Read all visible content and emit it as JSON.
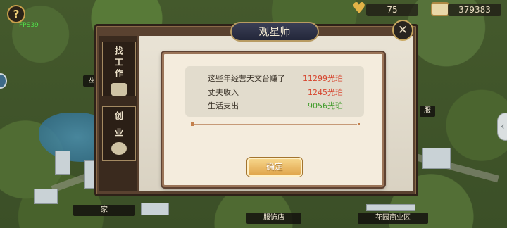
{
  "hud": {
    "help_icon": "?",
    "fps": "FPS39",
    "hearts_value": "75",
    "coins_value": "379383"
  },
  "panel": {
    "title": "观星师",
    "close_icon": "✕",
    "tabs": [
      {
        "label": "找工作",
        "icon": "briefcase-icon"
      },
      {
        "label": "创 业",
        "icon": "money-bag-icon"
      }
    ]
  },
  "dialog": {
    "rows": [
      {
        "label": "这些年经营天文台赚了",
        "value": "11299光珀",
        "color": "#d6452e"
      },
      {
        "label": "丈夫收入",
        "value": "1245光珀",
        "color": "#d6452e"
      },
      {
        "label": "生活支出",
        "value": "9056光珀",
        "color": "#3f9b2a"
      }
    ],
    "confirm_label": "确定"
  },
  "map_labels": {
    "home": "家",
    "clothing_store": "服饰店",
    "garden_business": "花园商业区",
    "partial_left": "巫",
    "partial_right": "服"
  },
  "colors": {
    "accent_red": "#d6452e",
    "accent_green": "#3f9b2a",
    "button_gold": "#e0a44a"
  }
}
